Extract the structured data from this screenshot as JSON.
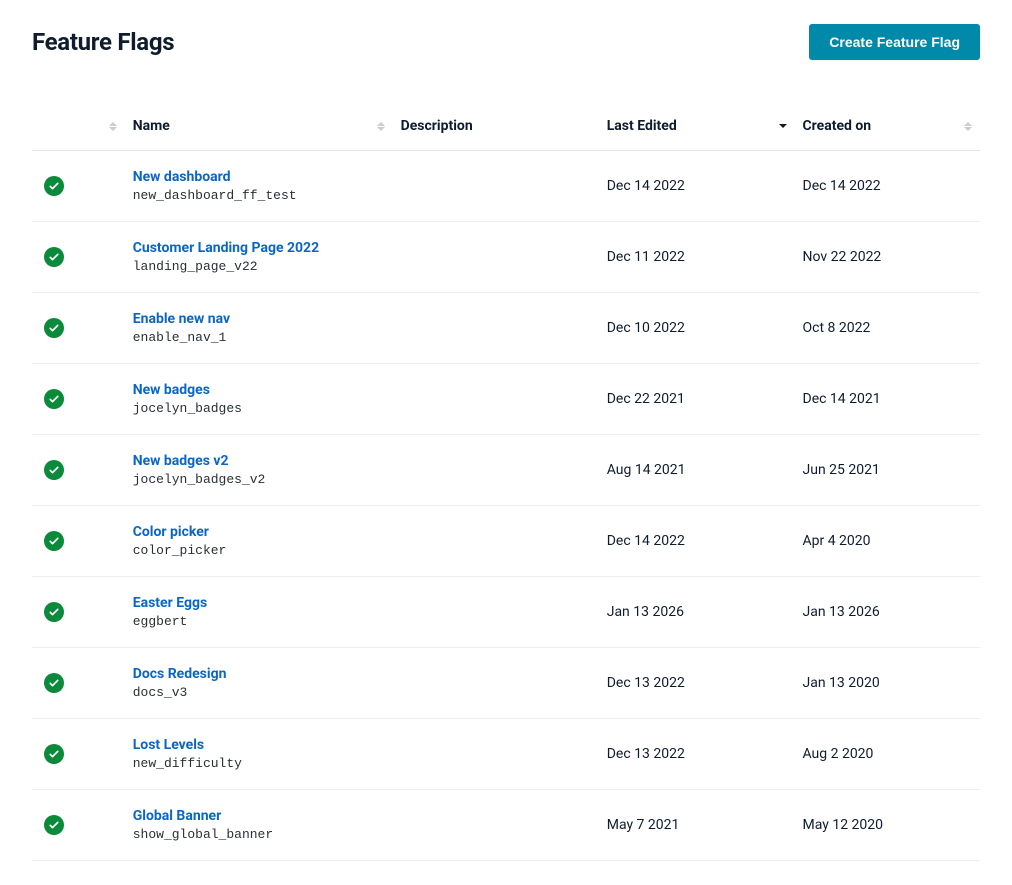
{
  "header": {
    "title": "Feature Flags",
    "create_button": "Create Feature Flag"
  },
  "columns": {
    "name": "Name",
    "description": "Description",
    "last_edited": "Last Edited",
    "created_on": "Created on"
  },
  "flags": [
    {
      "name": "New dashboard",
      "key": "new_dashboard_ff_test",
      "description": "",
      "last_edited": "Dec 14 2022",
      "created_on": "Dec 14 2022"
    },
    {
      "name": "Customer Landing Page 2022",
      "key": "landing_page_v22",
      "description": "",
      "last_edited": "Dec 11 2022",
      "created_on": "Nov 22 2022"
    },
    {
      "name": "Enable new nav",
      "key": "enable_nav_1",
      "description": "",
      "last_edited": "Dec 10 2022",
      "created_on": "Oct 8 2022"
    },
    {
      "name": "New badges",
      "key": "jocelyn_badges",
      "description": "",
      "last_edited": "Dec 22 2021",
      "created_on": "Dec 14 2021"
    },
    {
      "name": "New badges v2",
      "key": "jocelyn_badges_v2",
      "description": "",
      "last_edited": "Aug 14 2021",
      "created_on": "Jun 25 2021"
    },
    {
      "name": "Color picker",
      "key": "color_picker",
      "description": "",
      "last_edited": "Dec 14 2022",
      "created_on": "Apr 4 2020"
    },
    {
      "name": "Easter Eggs",
      "key": "eggbert",
      "description": "",
      "last_edited": "Jan 13 2026",
      "created_on": "Jan 13 2026"
    },
    {
      "name": "Docs Redesign",
      "key": "docs_v3",
      "description": "",
      "last_edited": "Dec 13 2022",
      "created_on": "Jan 13 2020"
    },
    {
      "name": "Lost Levels",
      "key": "new_difficulty",
      "description": "",
      "last_edited": "Dec 13 2022",
      "created_on": "Aug 2 2020"
    },
    {
      "name": "Global Banner",
      "key": "show_global_banner",
      "description": "",
      "last_edited": "May 7 2021",
      "created_on": "May 12 2020"
    }
  ]
}
